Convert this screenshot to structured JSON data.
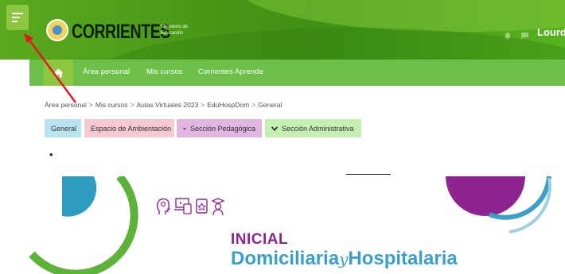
{
  "header": {
    "brand": "CORRIENTES",
    "ministry_line1": "Ministerio de",
    "ministry_line2": "Educación",
    "user_name": "Lourd",
    "icons": [
      "menu-icon",
      "bell-icon",
      "chat-icon"
    ]
  },
  "nav": {
    "home_icon": "home-icon",
    "items": [
      "Área personal",
      "Mis cursos",
      "Corrientes Aprende"
    ]
  },
  "breadcrumb": [
    "Área personal",
    "Mis cursos",
    "Aulas Virtuales 2023",
    "EduHospDom",
    "General"
  ],
  "tabs": [
    {
      "label": "General",
      "color": "#b9e3ee"
    },
    {
      "label": "Espacio de Ambientación",
      "color": "#f6c9d2"
    },
    {
      "label": "Sección Pedagógica",
      "color": "#e1b6e0"
    },
    {
      "label": "Sección Administrativa",
      "color": "#c6f0b3"
    }
  ],
  "bullet": "•",
  "banner": {
    "title_line1": "INICIAL",
    "title_part1": "Domiciliaria",
    "title_connector": "y",
    "title_part2": "Hospitalaria",
    "icons": [
      "idea-head-icon",
      "laptop-icon",
      "tablet-icon",
      "graduate-icon"
    ]
  },
  "colors": {
    "header_green": "#3f8f14",
    "nav_green": "#6cc04a",
    "accent_purple": "#8e248f",
    "accent_blue": "#3aa0c8",
    "arrow_red": "#e8121a"
  }
}
